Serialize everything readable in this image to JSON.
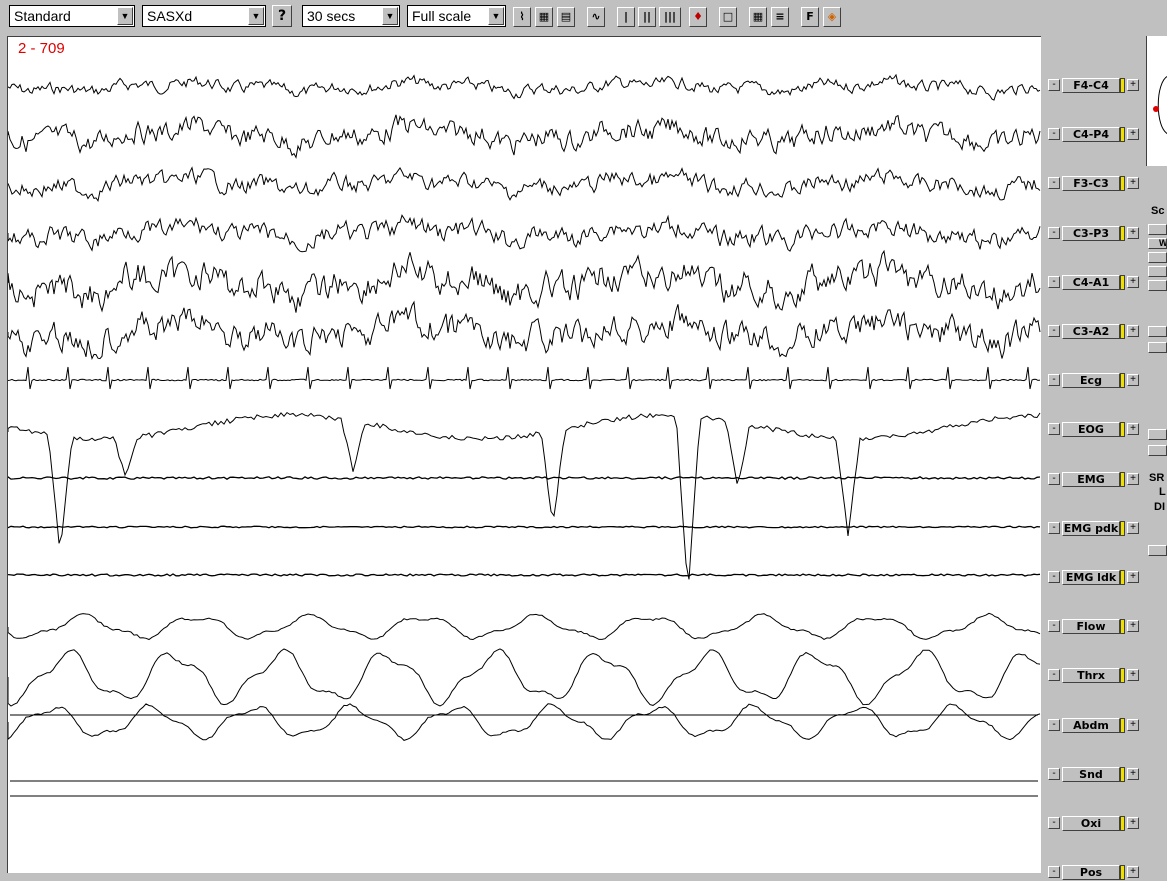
{
  "toolbar": {
    "montage": "Standard",
    "study": "SASXd",
    "timebase": "30 secs",
    "scale": "Full scale",
    "buttons": [
      "?",
      "F"
    ]
  },
  "plot": {
    "epoch_label": "2 - 709"
  },
  "channels": [
    {
      "label": "F4-C4"
    },
    {
      "label": "C4-P4"
    },
    {
      "label": "F3-C3"
    },
    {
      "label": "C3-P3"
    },
    {
      "label": "C4-A1"
    },
    {
      "label": "C3-A2"
    },
    {
      "label": "Ecg"
    },
    {
      "label": "EOG"
    },
    {
      "label": "EMG"
    },
    {
      "label": "EMG pdk"
    },
    {
      "label": "EMG ldk"
    },
    {
      "label": "Flow"
    },
    {
      "label": "Thrx"
    },
    {
      "label": "Abdm"
    },
    {
      "label": "Snd"
    },
    {
      "label": "Oxi"
    },
    {
      "label": "Pos"
    }
  ],
  "right_panel": {
    "labels": [
      "Sc",
      "W",
      "SR",
      "L",
      "DI"
    ]
  },
  "colors": {
    "background": "#c0c0c0",
    "epoch_label": "#e00000",
    "trace": "#000000",
    "channel_marker": "#f0e000"
  }
}
